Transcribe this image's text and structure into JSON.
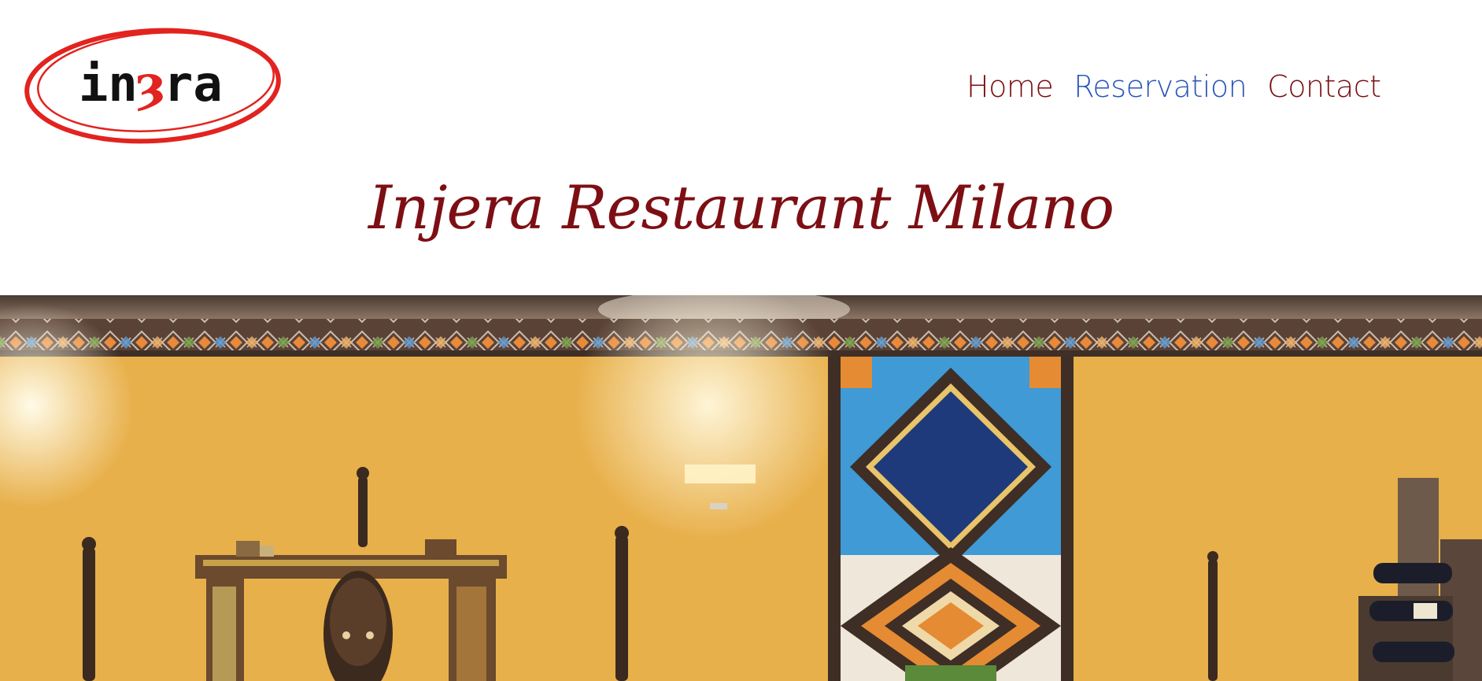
{
  "header": {
    "logo_alt": "injera logo",
    "nav": {
      "home": "Home",
      "reservation": "Reservation",
      "contact": "Contact",
      "active": "reservation"
    }
  },
  "page": {
    "title": "Injera Restaurant Milano"
  },
  "hero": {
    "description": "restaurant-interior-photo"
  },
  "colors": {
    "brand_red": "#7d0f14",
    "nav_text": "#7a0f12",
    "nav_active": "#2a55b8",
    "logo_ring": "#e2231f",
    "wall": "#e9b24e"
  }
}
